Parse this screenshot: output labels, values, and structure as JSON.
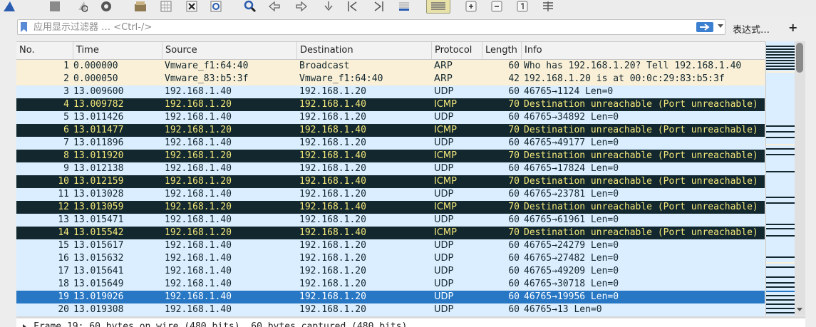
{
  "toolbar": {
    "icons": [
      "shark-fin-start-icon",
      "stop-icon",
      "restart-icon",
      "options-gear-icon",
      "open-file-icon",
      "save-file-icon",
      "close-file-icon",
      "reload-icon",
      "find-icon",
      "go-back-icon",
      "go-forward-icon",
      "go-to-packet-icon",
      "first-packet-icon",
      "last-packet-icon",
      "auto-scroll-icon",
      "colorize-icon",
      "zoom-in-icon",
      "zoom-out-icon",
      "normal-size-icon",
      "resize-columns-icon"
    ]
  },
  "filter": {
    "placeholder": "应用显示过滤器 … <Ctrl-/>",
    "value": "",
    "expression_label": "表达式…",
    "add_label": "+"
  },
  "columns": [
    "No.",
    "Time",
    "Source",
    "Destination",
    "Protocol",
    "Length",
    "Info"
  ],
  "packets": [
    {
      "no": "1",
      "time": "0.000000",
      "src": "Vmware_f1:64:40",
      "dst": "Broadcast",
      "proto": "ARP",
      "len": "60",
      "info": "Who has 192.168.1.20? Tell 192.168.1.40",
      "kind": "arp"
    },
    {
      "no": "2",
      "time": "0.000050",
      "src": "Vmware_83:b5:3f",
      "dst": "Vmware_f1:64:40",
      "proto": "ARP",
      "len": "42",
      "info": "192.168.1.20 is at 00:0c:29:83:b5:3f",
      "kind": "arp"
    },
    {
      "no": "3",
      "time": "13.009600",
      "src": "192.168.1.40",
      "dst": "192.168.1.20",
      "proto": "UDP",
      "len": "60",
      "info": "46765→1124 Len=0",
      "kind": "udp"
    },
    {
      "no": "4",
      "time": "13.009782",
      "src": "192.168.1.20",
      "dst": "192.168.1.40",
      "proto": "ICMP",
      "len": "70",
      "info": "Destination unreachable (Port unreachable)",
      "kind": "icmp"
    },
    {
      "no": "5",
      "time": "13.011426",
      "src": "192.168.1.40",
      "dst": "192.168.1.20",
      "proto": "UDP",
      "len": "60",
      "info": "46765→34892 Len=0",
      "kind": "udp"
    },
    {
      "no": "6",
      "time": "13.011477",
      "src": "192.168.1.20",
      "dst": "192.168.1.40",
      "proto": "ICMP",
      "len": "70",
      "info": "Destination unreachable (Port unreachable)",
      "kind": "icmp"
    },
    {
      "no": "7",
      "time": "13.011896",
      "src": "192.168.1.40",
      "dst": "192.168.1.20",
      "proto": "UDP",
      "len": "60",
      "info": "46765→49177 Len=0",
      "kind": "udp"
    },
    {
      "no": "8",
      "time": "13.011920",
      "src": "192.168.1.20",
      "dst": "192.168.1.40",
      "proto": "ICMP",
      "len": "70",
      "info": "Destination unreachable (Port unreachable)",
      "kind": "icmp"
    },
    {
      "no": "9",
      "time": "13.012138",
      "src": "192.168.1.40",
      "dst": "192.168.1.20",
      "proto": "UDP",
      "len": "60",
      "info": "46765→17824 Len=0",
      "kind": "udp"
    },
    {
      "no": "10",
      "time": "13.012159",
      "src": "192.168.1.20",
      "dst": "192.168.1.40",
      "proto": "ICMP",
      "len": "70",
      "info": "Destination unreachable (Port unreachable)",
      "kind": "icmp"
    },
    {
      "no": "11",
      "time": "13.013028",
      "src": "192.168.1.40",
      "dst": "192.168.1.20",
      "proto": "UDP",
      "len": "60",
      "info": "46765→23781 Len=0",
      "kind": "udp"
    },
    {
      "no": "12",
      "time": "13.013059",
      "src": "192.168.1.20",
      "dst": "192.168.1.40",
      "proto": "ICMP",
      "len": "70",
      "info": "Destination unreachable (Port unreachable)",
      "kind": "icmp"
    },
    {
      "no": "13",
      "time": "13.015471",
      "src": "192.168.1.40",
      "dst": "192.168.1.20",
      "proto": "UDP",
      "len": "60",
      "info": "46765→61961 Len=0",
      "kind": "udp"
    },
    {
      "no": "14",
      "time": "13.015542",
      "src": "192.168.1.20",
      "dst": "192.168.1.40",
      "proto": "ICMP",
      "len": "70",
      "info": "Destination unreachable (Port unreachable)",
      "kind": "icmp"
    },
    {
      "no": "15",
      "time": "13.015617",
      "src": "192.168.1.40",
      "dst": "192.168.1.20",
      "proto": "UDP",
      "len": "60",
      "info": "46765→24279 Len=0",
      "kind": "udp"
    },
    {
      "no": "16",
      "time": "13.015632",
      "src": "192.168.1.40",
      "dst": "192.168.1.20",
      "proto": "UDP",
      "len": "60",
      "info": "46765→27482 Len=0",
      "kind": "udp"
    },
    {
      "no": "17",
      "time": "13.015641",
      "src": "192.168.1.40",
      "dst": "192.168.1.20",
      "proto": "UDP",
      "len": "60",
      "info": "46765→49209 Len=0",
      "kind": "udp"
    },
    {
      "no": "18",
      "time": "13.015649",
      "src": "192.168.1.40",
      "dst": "192.168.1.20",
      "proto": "UDP",
      "len": "60",
      "info": "46765→30718 Len=0",
      "kind": "udp"
    },
    {
      "no": "19",
      "time": "13.019026",
      "src": "192.168.1.40",
      "dst": "192.168.1.20",
      "proto": "UDP",
      "len": "60",
      "info": "46765→19956 Len=0",
      "kind": "sel"
    },
    {
      "no": "20",
      "time": "13.019308",
      "src": "192.168.1.40",
      "dst": "192.168.1.20",
      "proto": "UDP",
      "len": "60",
      "info": "46765→13 Len=0",
      "kind": "udp"
    }
  ],
  "details": {
    "text": "Frame 19: 60 bytes on wire (480 bits), 60 bytes captured (480 bits)"
  },
  "colors": {
    "arp_bg": "#faf0d7",
    "udp_bg": "#daeeff",
    "icmp_bg": "#12272e",
    "icmp_fg": "#f4e77a",
    "selected_bg": "#2877c4"
  }
}
